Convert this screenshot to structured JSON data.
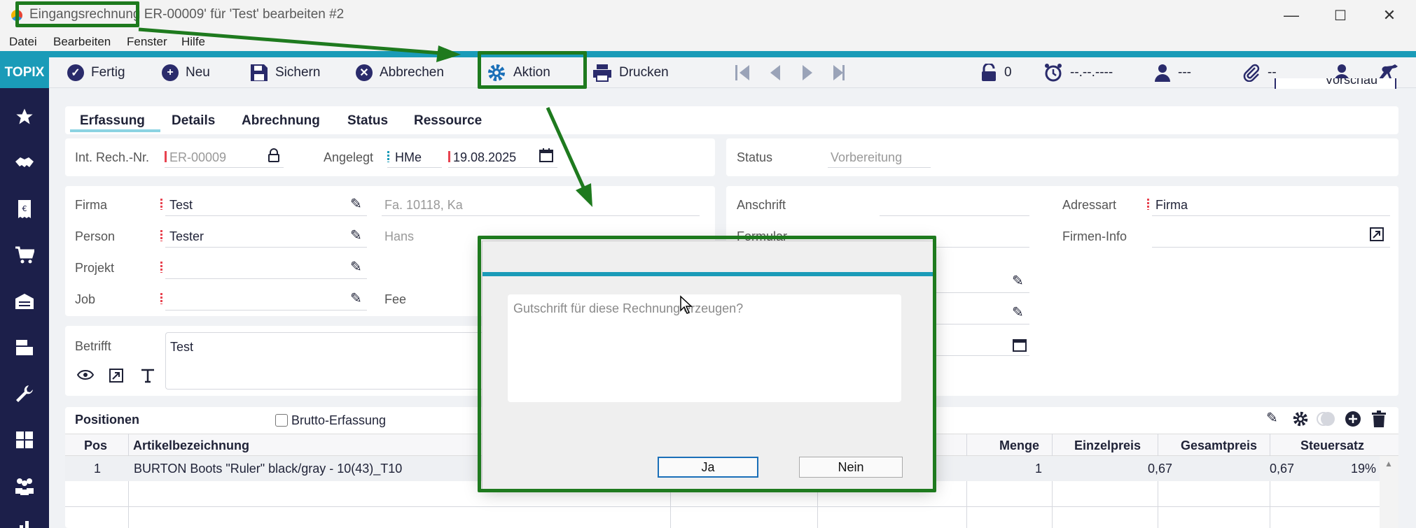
{
  "window": {
    "title_highlight": "Eingangsrechnung",
    "title_rest": "ER-00009' für 'Test' bearbeiten #2",
    "minimize": "—",
    "maximize": "☐",
    "close": "✕"
  },
  "menu": {
    "items": [
      "Datei",
      "Bearbeiten",
      "Fenster",
      "Hilfe"
    ]
  },
  "brand": "TOPIX",
  "toolbar": {
    "fertig": "Fertig",
    "neu": "Neu",
    "sichern": "Sichern",
    "abbrechen": "Abbrechen",
    "aktion": "Aktion",
    "drucken": "Drucken",
    "lock_count": "0",
    "alarm_value": "--.--.----",
    "user_value": "---",
    "attach_value": "--",
    "vorschau": "Vorschau"
  },
  "tabs": [
    "Erfassung",
    "Details",
    "Abrechnung",
    "Status",
    "Ressource"
  ],
  "header_row": {
    "int_rech_label": "Int. Rech.-Nr.",
    "int_rech_value": "ER-00009",
    "angelegt_label": "Angelegt",
    "angelegt_user": "HMe",
    "angelegt_date": "19.08.2025",
    "status_label": "Status",
    "status_value": "Vorbereitung"
  },
  "left_form": {
    "firma_label": "Firma",
    "firma_value": "Test",
    "firma_info": "Fa. 10118, Ka",
    "person_label": "Person",
    "person_value": "Tester",
    "person_info": "Hans",
    "projekt_label": "Projekt",
    "job_label": "Job",
    "fee_label": "Fee"
  },
  "right_form": {
    "anschrift_label": "Anschrift",
    "formular_label": "Formular",
    "adressart_label": "Adressart",
    "adressart_value": "Firma",
    "firmeninfo_label": "Firmen-Info"
  },
  "betrifft": {
    "label": "Betrifft",
    "value": "Test"
  },
  "positionen": {
    "title": "Positionen",
    "brutto_label": "Brutto-Erfassung",
    "columns": {
      "pos": "Pos",
      "artikel": "Artikelbezeichnung",
      "menge": "Menge",
      "einzelpreis": "Einzelpreis",
      "gesamtpreis": "Gesamtpreis",
      "steuersatz": "Steuersatz"
    },
    "rows": [
      {
        "pos": "1",
        "artikel": "BURTON Boots \"Ruler\" black/gray - 10(43)_T10",
        "menge": "1",
        "einzelpreis": "0,67",
        "gesamtpreis": "0,67",
        "steuersatz": "19%"
      }
    ]
  },
  "dialog": {
    "message": "Gutschrift für diese Rechnung erzeugen?",
    "yes": "Ja",
    "no": "Nein"
  },
  "colors": {
    "accent": "#1a9bb8",
    "nav": "#1c1f4a",
    "annotation": "#1e7a1e",
    "required": "#e84350"
  }
}
